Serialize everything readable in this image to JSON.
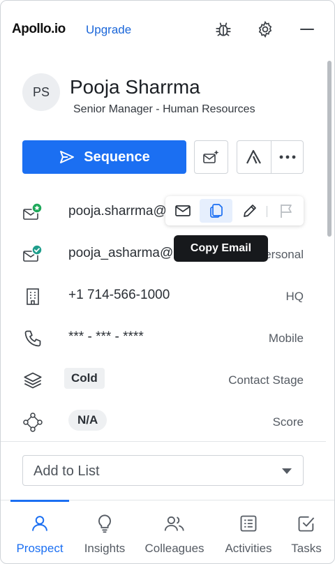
{
  "header": {
    "logo_text": "Apollo.io",
    "upgrade_label": "Upgrade",
    "icons": [
      "bug-icon",
      "gear-icon",
      "minimize-icon"
    ]
  },
  "profile": {
    "initials": "PS",
    "name": "Pooja Sharrma",
    "title": "Senior Manager - Human Resources"
  },
  "actions": {
    "sequence_label": "Sequence",
    "accent_color": "#1b6ff2"
  },
  "rows": [
    {
      "icon": "email-verified-star-icon",
      "value": "pooja.sharrma@",
      "label": ""
    },
    {
      "icon": "email-verified-check-icon",
      "value": "pooja_asharma@",
      "label": "Personal"
    },
    {
      "icon": "building-icon",
      "value": "+1 714-566-1000",
      "label": "HQ"
    },
    {
      "icon": "phone-icon",
      "value": "*** - *** - ****",
      "label": "Mobile"
    },
    {
      "icon": "layers-icon",
      "value": "Cold",
      "label": "Contact Stage"
    },
    {
      "icon": "score-nodes-icon",
      "value": "N/A",
      "label": "Score"
    }
  ],
  "hover_toolbar": {
    "icons": [
      "mail-icon",
      "copy-icon",
      "edit-icon",
      "flag-icon"
    ],
    "tooltip": "Copy Email"
  },
  "add_to_list": {
    "placeholder": "Add to List"
  },
  "nav": {
    "items": [
      {
        "label": "Prospect",
        "icon": "person-icon",
        "active": true
      },
      {
        "label": "Insights",
        "icon": "lightbulb-icon",
        "active": false
      },
      {
        "label": "Colleagues",
        "icon": "people-icon",
        "active": false
      },
      {
        "label": "Activities",
        "icon": "activities-icon",
        "active": false
      },
      {
        "label": "Tasks",
        "icon": "tasks-icon",
        "active": false
      }
    ]
  }
}
